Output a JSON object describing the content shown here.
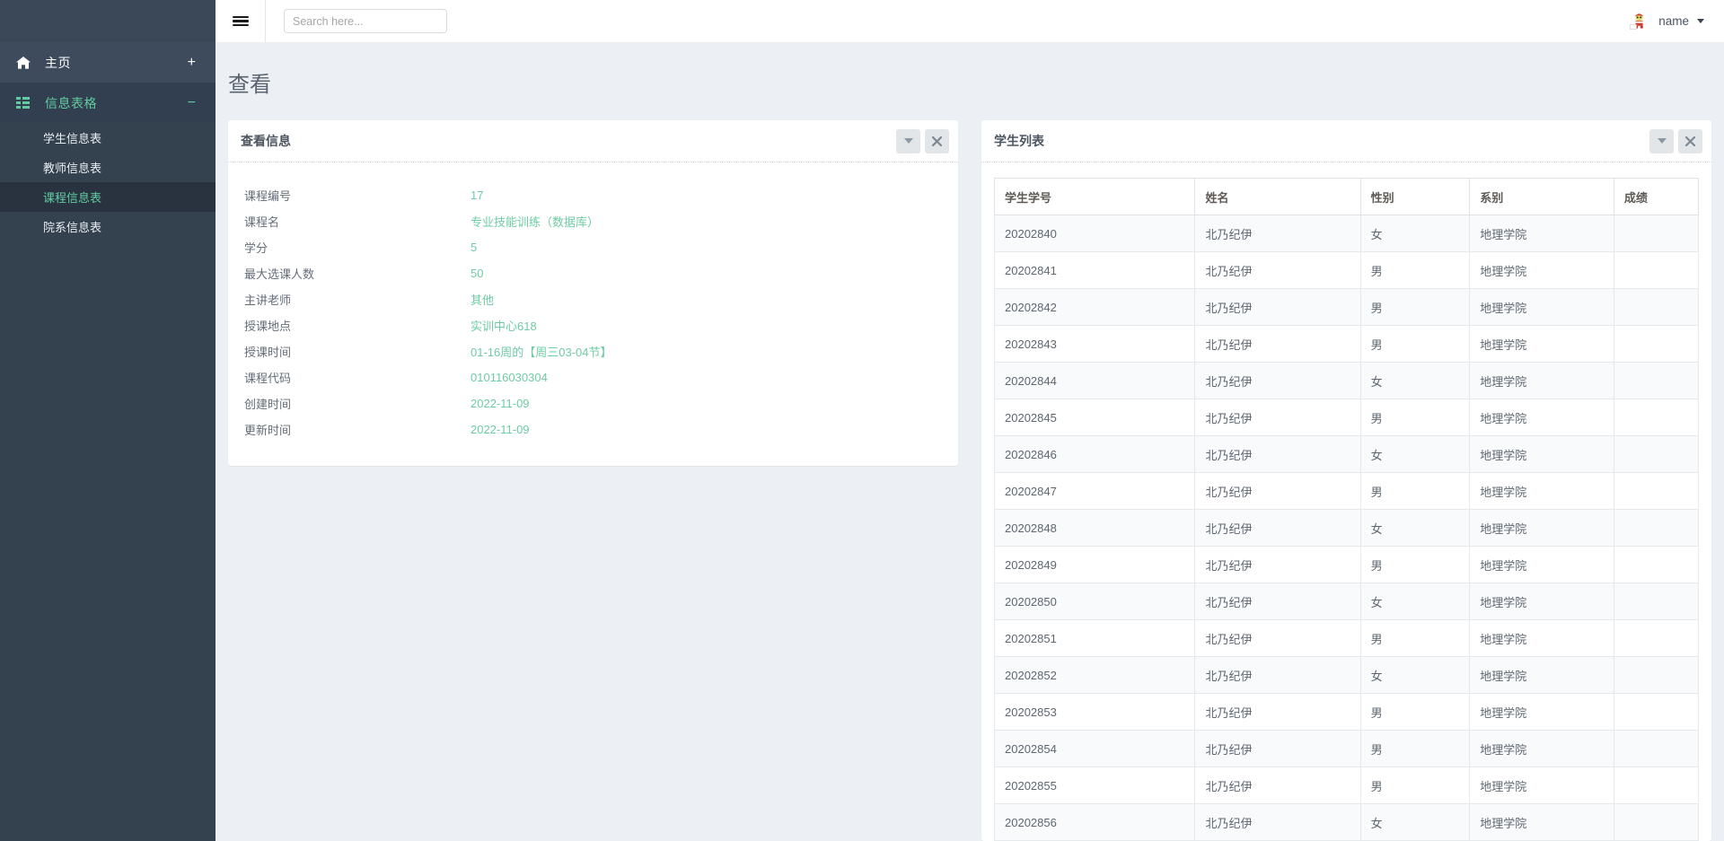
{
  "sidebar": {
    "home": {
      "label": "主页",
      "icon": "home-icon",
      "sign": "+"
    },
    "group": {
      "label": "信息表格",
      "icon": "grid-icon",
      "sign": "−"
    },
    "sub_items": [
      {
        "label": "学生信息表",
        "active": false
      },
      {
        "label": "教师信息表",
        "active": false
      },
      {
        "label": "课程信息表",
        "active": true
      },
      {
        "label": "院系信息表",
        "active": false
      }
    ]
  },
  "topbar": {
    "menu_icon": "hamburger-icon",
    "search_placeholder": "Search here...",
    "search_value": "",
    "user_name": "name",
    "caret_icon": "caret-down-icon"
  },
  "page": {
    "title": "查看"
  },
  "left_panel": {
    "title": "查看信息",
    "collapse_icon": "chevron-down-icon",
    "close_icon": "close-icon",
    "fields": [
      {
        "label": "课程编号",
        "value": "17"
      },
      {
        "label": "课程名",
        "value": "专业技能训练（数据库）"
      },
      {
        "label": "学分",
        "value": "5"
      },
      {
        "label": "最大选课人数",
        "value": "50"
      },
      {
        "label": "主讲老师",
        "value": "其他"
      },
      {
        "label": "授课地点",
        "value": "实训中心618"
      },
      {
        "label": "授课时间",
        "value": "01-16周的【周三03-04节】"
      },
      {
        "label": "课程代码",
        "value": "010116030304"
      },
      {
        "label": "创建时间",
        "value": "2022-11-09"
      },
      {
        "label": "更新时间",
        "value": "2022-11-09"
      }
    ]
  },
  "right_panel": {
    "title": "学生列表",
    "collapse_icon": "chevron-down-icon",
    "close_icon": "close-icon",
    "columns": [
      "学生学号",
      "姓名",
      "性别",
      "系别",
      "成绩"
    ],
    "rows": [
      {
        "id": "20202840",
        "name": "北乃纪伊",
        "gender": "女",
        "dept": "地理学院",
        "score": ""
      },
      {
        "id": "20202841",
        "name": "北乃纪伊",
        "gender": "男",
        "dept": "地理学院",
        "score": ""
      },
      {
        "id": "20202842",
        "name": "北乃纪伊",
        "gender": "男",
        "dept": "地理学院",
        "score": ""
      },
      {
        "id": "20202843",
        "name": "北乃纪伊",
        "gender": "男",
        "dept": "地理学院",
        "score": ""
      },
      {
        "id": "20202844",
        "name": "北乃纪伊",
        "gender": "女",
        "dept": "地理学院",
        "score": ""
      },
      {
        "id": "20202845",
        "name": "北乃纪伊",
        "gender": "男",
        "dept": "地理学院",
        "score": ""
      },
      {
        "id": "20202846",
        "name": "北乃纪伊",
        "gender": "女",
        "dept": "地理学院",
        "score": ""
      },
      {
        "id": "20202847",
        "name": "北乃纪伊",
        "gender": "男",
        "dept": "地理学院",
        "score": ""
      },
      {
        "id": "20202848",
        "name": "北乃纪伊",
        "gender": "女",
        "dept": "地理学院",
        "score": ""
      },
      {
        "id": "20202849",
        "name": "北乃纪伊",
        "gender": "男",
        "dept": "地理学院",
        "score": ""
      },
      {
        "id": "20202850",
        "name": "北乃纪伊",
        "gender": "女",
        "dept": "地理学院",
        "score": ""
      },
      {
        "id": "20202851",
        "name": "北乃纪伊",
        "gender": "男",
        "dept": "地理学院",
        "score": ""
      },
      {
        "id": "20202852",
        "name": "北乃纪伊",
        "gender": "女",
        "dept": "地理学院",
        "score": ""
      },
      {
        "id": "20202853",
        "name": "北乃纪伊",
        "gender": "男",
        "dept": "地理学院",
        "score": ""
      },
      {
        "id": "20202854",
        "name": "北乃纪伊",
        "gender": "男",
        "dept": "地理学院",
        "score": ""
      },
      {
        "id": "20202855",
        "name": "北乃纪伊",
        "gender": "男",
        "dept": "地理学院",
        "score": ""
      },
      {
        "id": "20202856",
        "name": "北乃纪伊",
        "gender": "女",
        "dept": "地理学院",
        "score": ""
      }
    ]
  },
  "colors": {
    "accent_green": "#6ecca4",
    "sidebar_bg": "#34414f",
    "sidebar_active": "#28333f",
    "page_bg": "#ecf0f4"
  }
}
